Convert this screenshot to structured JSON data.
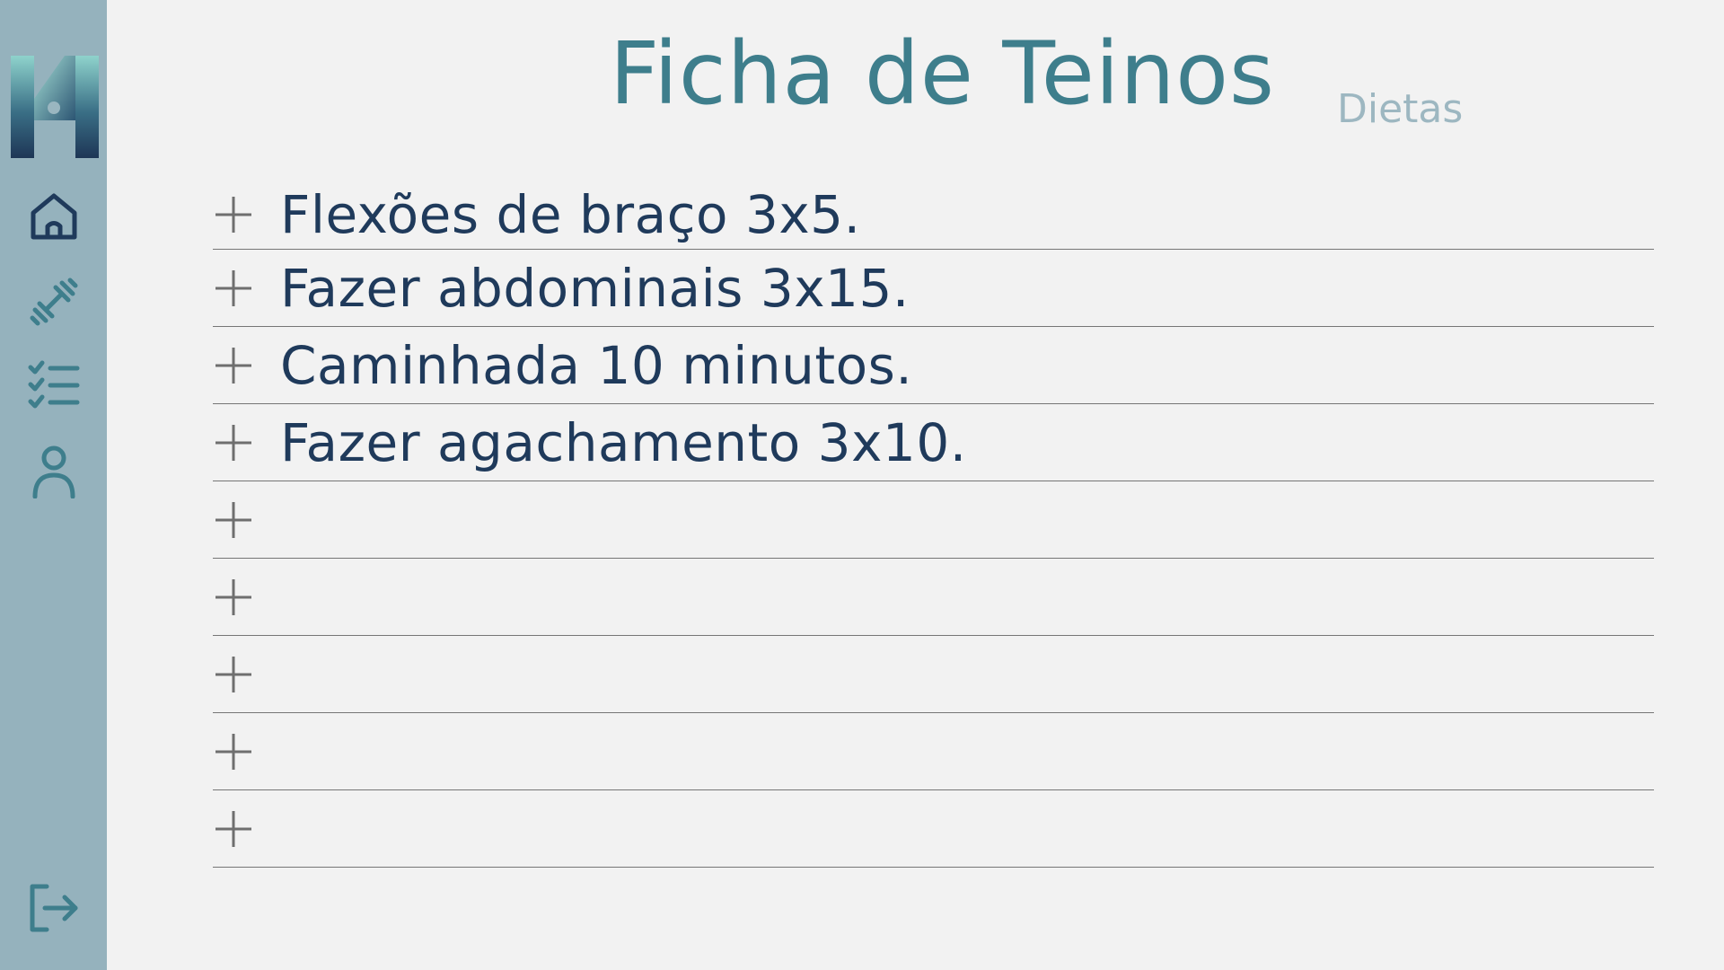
{
  "header": {
    "title": "Ficha de Teinos",
    "secondary_tab": "Dietas"
  },
  "sidebar": {
    "items": [
      {
        "name": "home",
        "icon": "home-icon"
      },
      {
        "name": "workouts",
        "icon": "dumbbell-icon"
      },
      {
        "name": "checklist",
        "icon": "checklist-icon"
      },
      {
        "name": "profile",
        "icon": "user-icon"
      }
    ],
    "logout_icon": "logout-icon",
    "logo_icon": "logo-icon"
  },
  "tasks": [
    {
      "text": "Flexões de braço 3x5."
    },
    {
      "text": "Fazer abdominais 3x15."
    },
    {
      "text": "Caminhada 10 minutos."
    },
    {
      "text": "Fazer agachamento 3x10."
    },
    {
      "text": ""
    },
    {
      "text": ""
    },
    {
      "text": ""
    },
    {
      "text": ""
    },
    {
      "text": ""
    }
  ],
  "colors": {
    "sidebar": "#95b2bd",
    "background": "#f2f2f2",
    "title": "#3e7e8c",
    "tab_inactive": "#9db7c1",
    "task_text": "#1f3a5b",
    "icon_dark": "#1f3a5b",
    "icon_teal": "#3e7e8c"
  }
}
